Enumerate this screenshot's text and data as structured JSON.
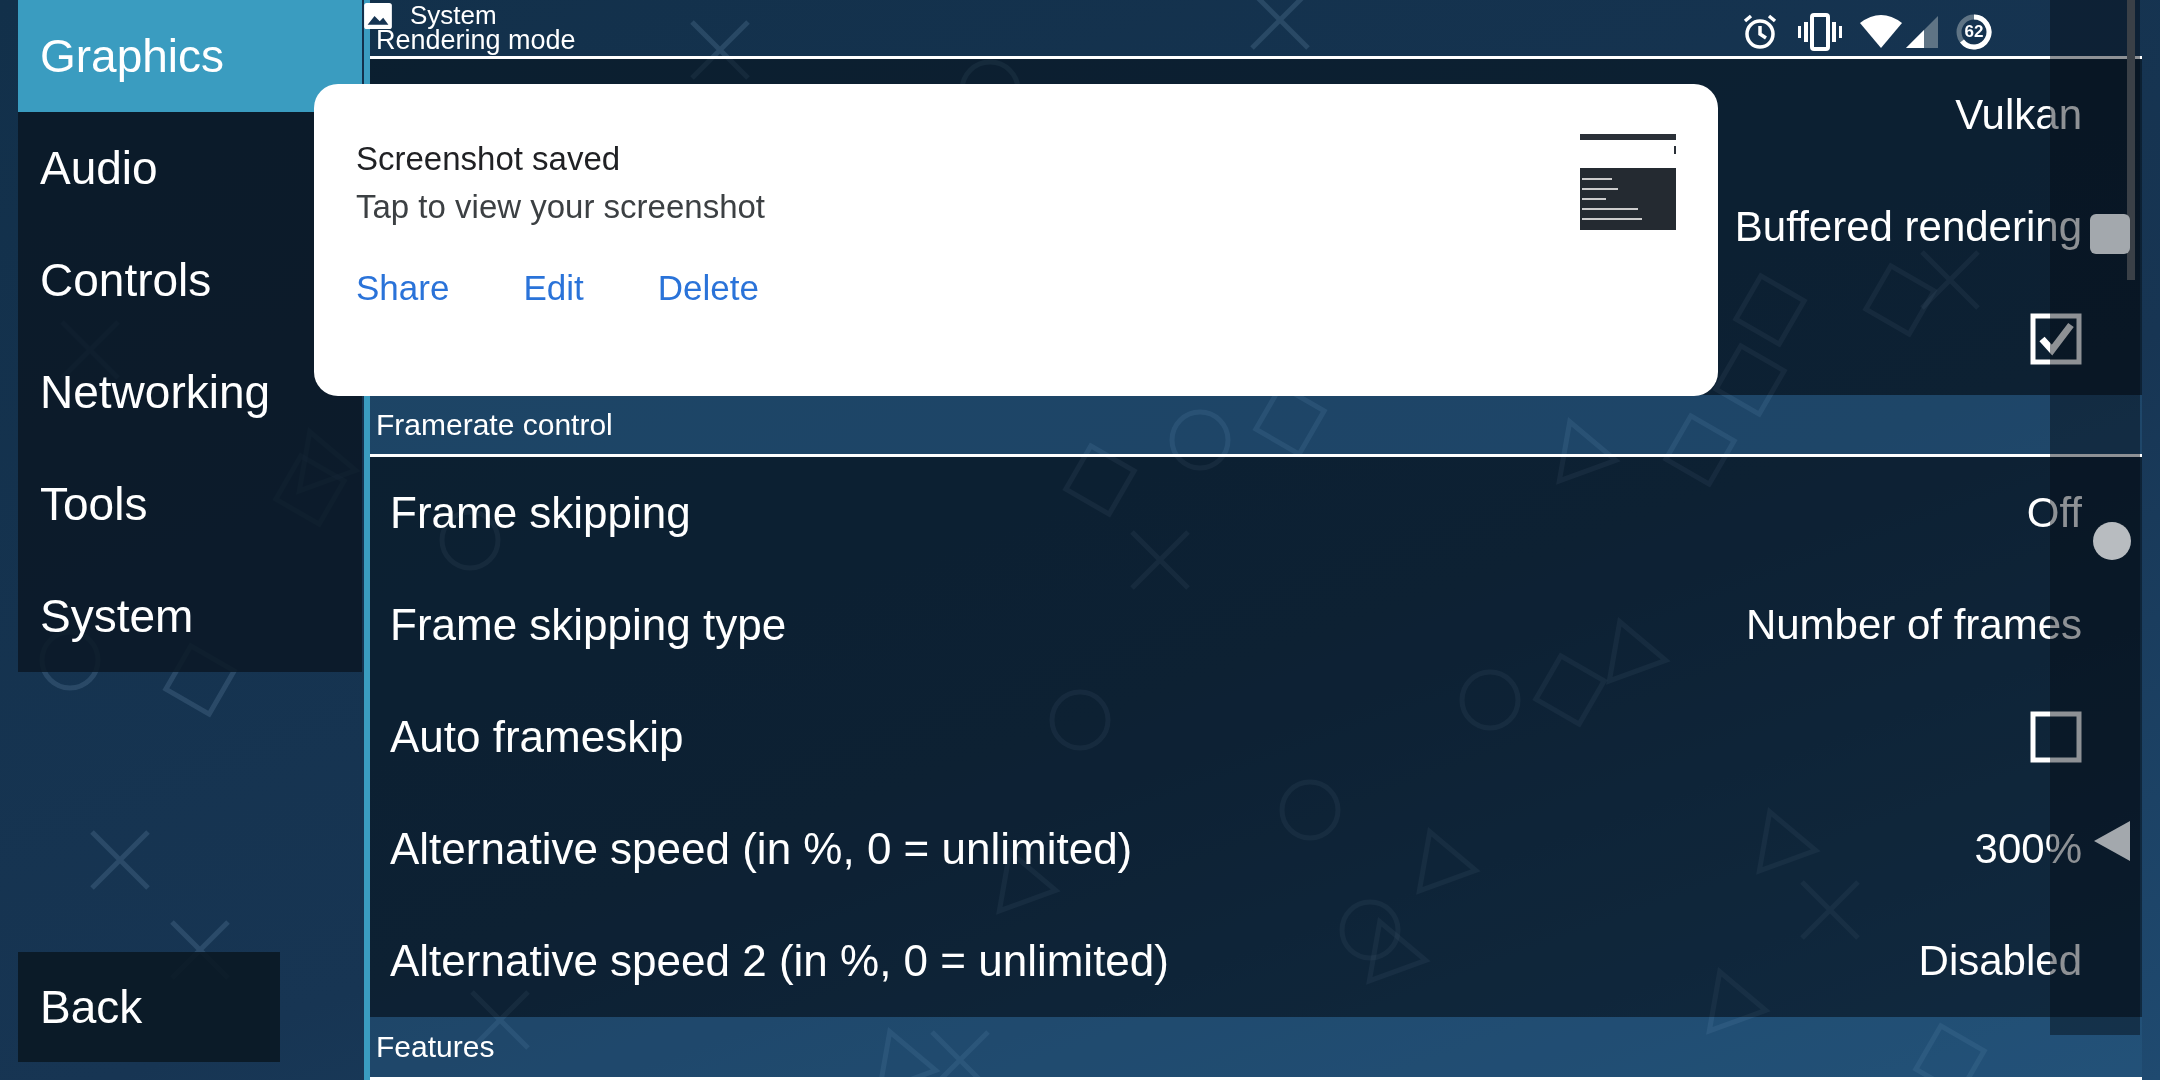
{
  "status_bar": {
    "notification_title": "System",
    "battery": "62"
  },
  "sidebar": {
    "items": [
      {
        "label": "Graphics",
        "selected": true
      },
      {
        "label": "Audio",
        "selected": false
      },
      {
        "label": "Controls",
        "selected": false
      },
      {
        "label": "Networking",
        "selected": false
      },
      {
        "label": "Tools",
        "selected": false
      },
      {
        "label": "System",
        "selected": false
      }
    ],
    "back_button": "Back"
  },
  "settings": {
    "sections": [
      {
        "title": "Rendering mode",
        "rows": [
          {
            "kind": "value",
            "value": "Vulkan"
          },
          {
            "kind": "value",
            "value": "Buffered rendering"
          },
          {
            "kind": "checkbox",
            "checked": true
          }
        ]
      },
      {
        "title": "Framerate control",
        "rows": [
          {
            "kind": "value",
            "label": "Frame skipping",
            "value": "Off"
          },
          {
            "kind": "value",
            "label": "Frame skipping type",
            "value": "Number of frames"
          },
          {
            "kind": "checkbox",
            "label": "Auto frameskip",
            "checked": false
          },
          {
            "kind": "value",
            "label": "Alternative speed (in %, 0 = unlimited)",
            "value": "300%"
          },
          {
            "kind": "value",
            "label": "Alternative speed 2 (in %, 0 = unlimited)",
            "value": "Disabled"
          }
        ]
      },
      {
        "title": "Features"
      }
    ]
  },
  "notification": {
    "title": "Screenshot saved",
    "text": "Tap to view your screenshot",
    "actions": [
      "Share",
      "Edit",
      "Delete"
    ]
  }
}
